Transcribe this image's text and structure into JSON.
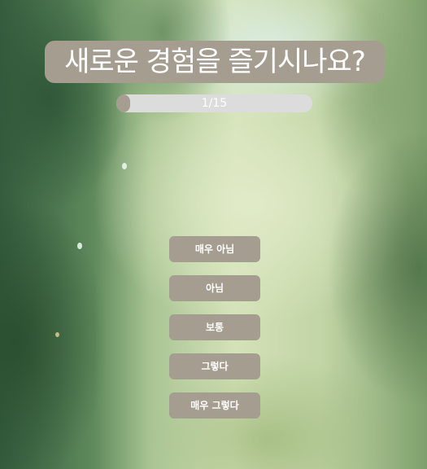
{
  "question": {
    "text": "새로운 경험을 즐기시나요?"
  },
  "progress": {
    "current": 1,
    "total": 15,
    "label": "1/15"
  },
  "options": [
    {
      "label": "매우 아님"
    },
    {
      "label": "아님"
    },
    {
      "label": "보통"
    },
    {
      "label": "그렇다"
    },
    {
      "label": "매우 그렇다"
    }
  ],
  "colors": {
    "accent": "#a59d90",
    "track": "#dcdcdc",
    "text": "#ffffff"
  }
}
